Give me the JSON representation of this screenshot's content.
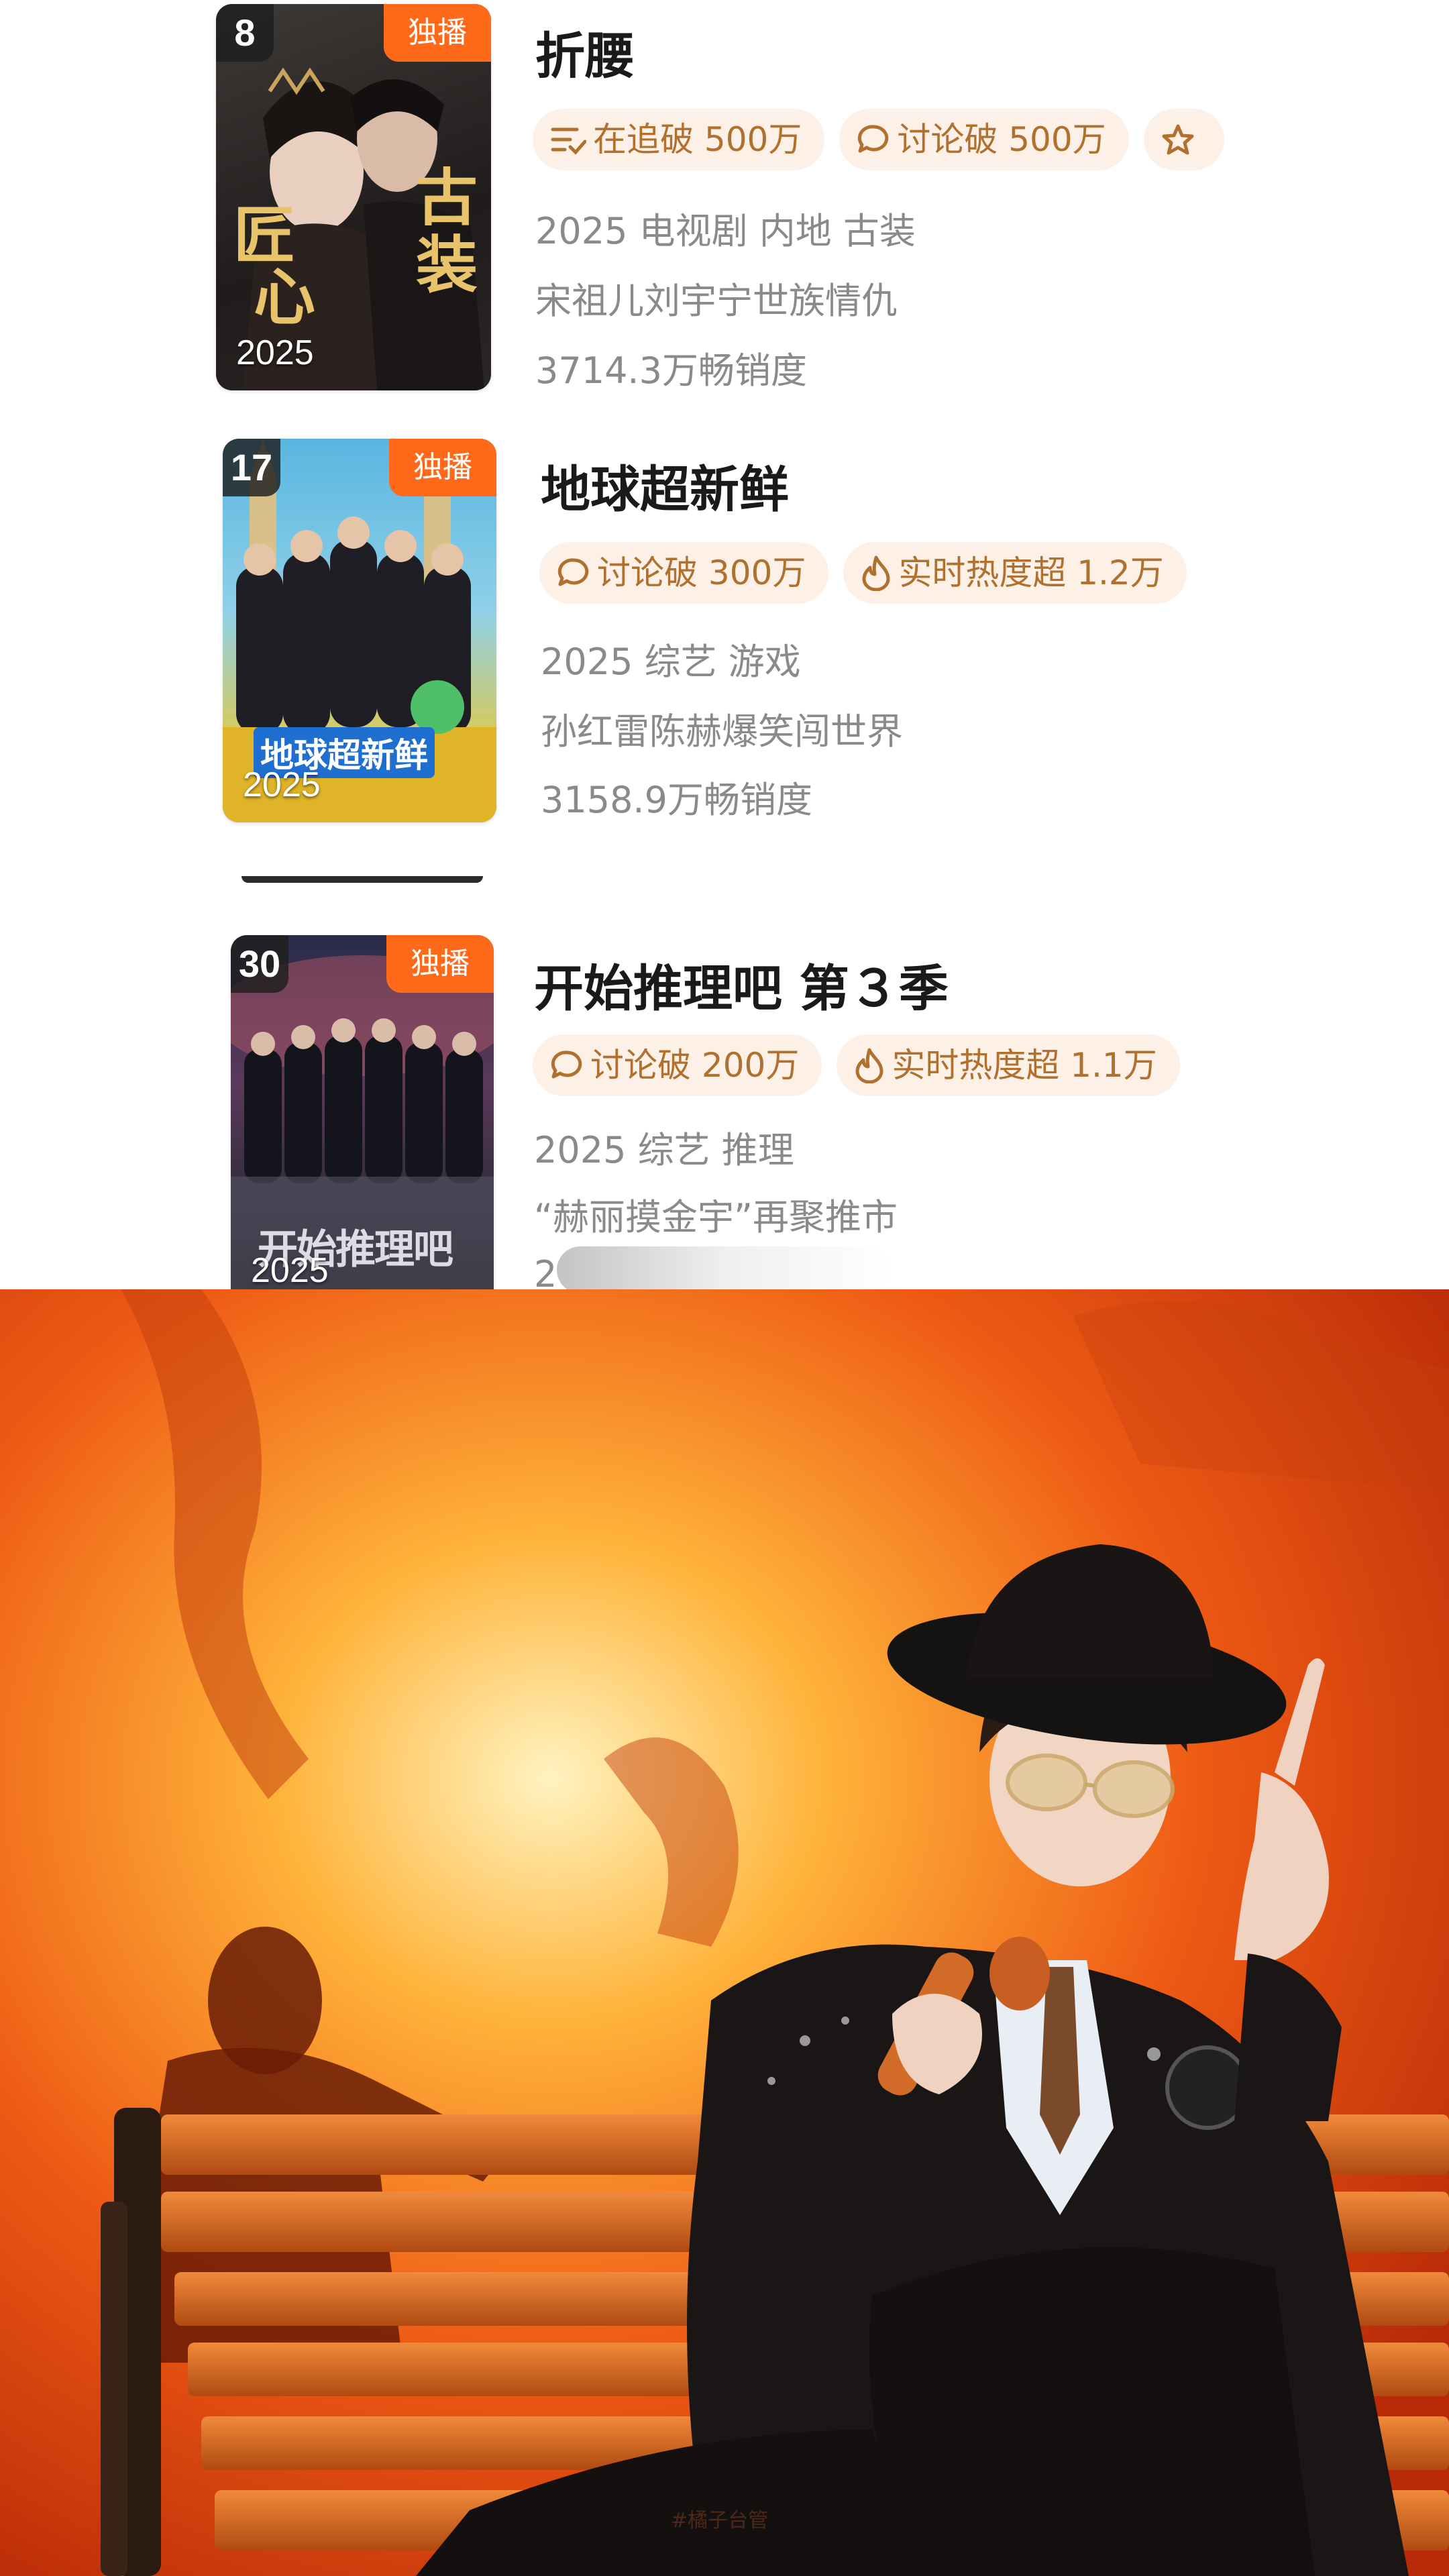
{
  "items": [
    {
      "rank": "8",
      "badge": "独播",
      "poster_year": "2025",
      "poster_art_text": [
        "匠",
        "心",
        "古",
        "装"
      ],
      "title": "折腰",
      "tags": [
        {
          "icon": "list-check-icon",
          "label": "在追破 500万"
        },
        {
          "icon": "chat-bubble-icon",
          "label": "讨论破 500万"
        },
        {
          "icon": "star-icon",
          "label": ""
        }
      ],
      "info": "2025 电视剧 内地 古装",
      "desc": "宋祖儿刘宇宁世族情仇",
      "sales": "3714.3万畅销度"
    },
    {
      "rank": "17",
      "badge": "独播",
      "poster_year": "2025",
      "poster_art_text": [
        "地球超新鲜"
      ],
      "title": "地球超新鲜",
      "tags": [
        {
          "icon": "chat-bubble-icon",
          "label": "讨论破 300万"
        },
        {
          "icon": "flame-icon",
          "label": "实时热度超 1.2万"
        }
      ],
      "info": "2025 综艺 游戏",
      "desc": "孙红雷陈赫爆笑闯世界",
      "sales": "3158.9万畅销度"
    },
    {
      "rank": "30",
      "badge": "独播",
      "poster_year": "2025",
      "poster_art_text": [
        "开始推理吧"
      ],
      "title": "开始推理吧 第３季",
      "tags": [
        {
          "icon": "chat-bubble-icon",
          "label": "讨论破 200万"
        },
        {
          "icon": "flame-icon",
          "label": "实时热度超 1.1万"
        }
      ],
      "info": "2025 综艺 推理",
      "desc": "“赫丽摸金宇”再聚推市",
      "sales": "2"
    }
  ],
  "photo": {
    "watermark": "#橘子台管"
  },
  "colors": {
    "badge_orange": "#ff6a1a",
    "tag_bg": "#fdf0e6",
    "tag_text": "#b0702e",
    "meta_gray": "#8a8a8a"
  }
}
